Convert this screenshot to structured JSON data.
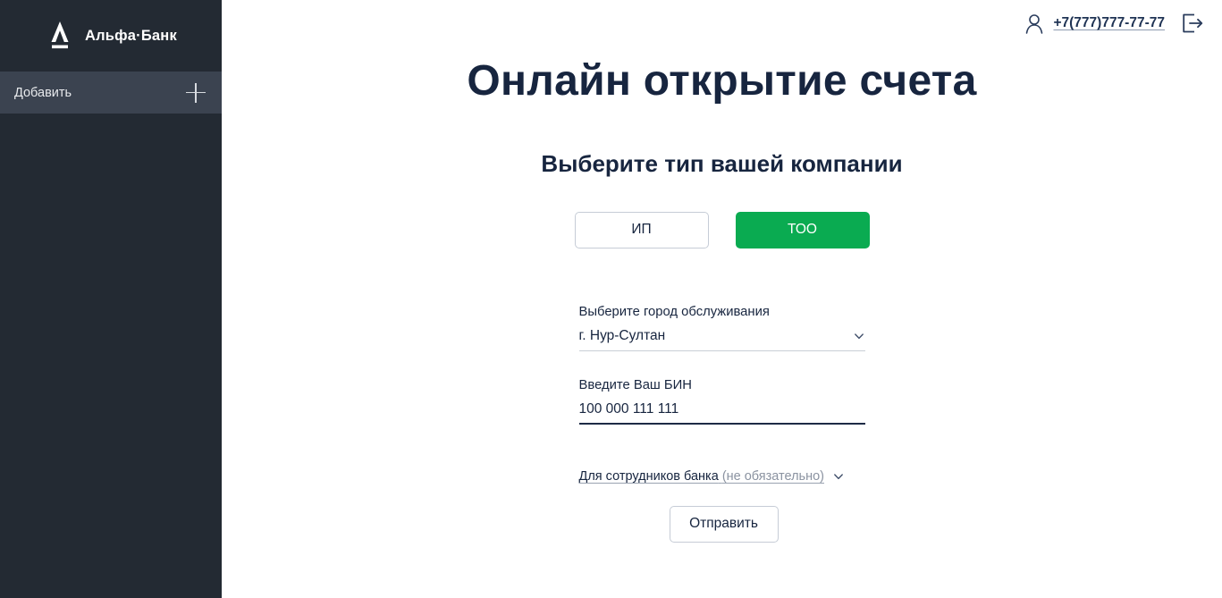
{
  "sidebar": {
    "brand_name": "Альфа·Банк",
    "logo_icon": "alfa-bank-a-logo",
    "add_item": {
      "label": "Добавить",
      "icon": "plus-icon"
    }
  },
  "topbar": {
    "user_icon": "user-person-icon",
    "phone": "+7(777)777-77-77",
    "logout_icon": "logout-exit-icon"
  },
  "page": {
    "title": "Онлайн открытие счета",
    "subtitle": "Выберите тип вашей компании"
  },
  "company_type": {
    "options": [
      {
        "label": "ИП",
        "selected": false
      },
      {
        "label": "ТОО",
        "selected": true
      }
    ],
    "selected_value": "ТОО"
  },
  "form": {
    "city": {
      "label": "Выберите город обслуживания",
      "value": "г. Нур-Султан",
      "icon": "chevron-down-icon"
    },
    "bin": {
      "label": "Введите Ваш БИН",
      "value": "100 000 111 111",
      "placeholder": "Введите Ваш БИН"
    },
    "bank_staff": {
      "label": "Для сотрудников банка",
      "optional": "(не обязательно)",
      "icon": "chevron-down-icon"
    },
    "submit": {
      "label": "Отправить"
    }
  },
  "colors": {
    "sidebar_bg": "#232a33",
    "sidebar_active_bg": "#3b4350",
    "accent_green": "#0aab51",
    "text_navy": "#17253f",
    "muted_gray": "#8b93a1",
    "border_gray": "#c6ccd6"
  }
}
